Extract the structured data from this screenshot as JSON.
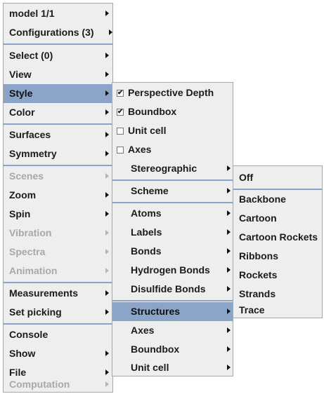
{
  "main_menu": {
    "items": [
      {
        "label": "model 1/1"
      },
      {
        "label": "Configurations (3)"
      },
      {
        "label": "Select (0)"
      },
      {
        "label": "View"
      },
      {
        "label": "Style"
      },
      {
        "label": "Color"
      },
      {
        "label": "Surfaces"
      },
      {
        "label": "Symmetry"
      },
      {
        "label": "Scenes"
      },
      {
        "label": "Zoom"
      },
      {
        "label": "Spin"
      },
      {
        "label": "Vibration"
      },
      {
        "label": "Spectra"
      },
      {
        "label": "Animation"
      },
      {
        "label": "Measurements"
      },
      {
        "label": "Set picking"
      },
      {
        "label": "Console"
      },
      {
        "label": "Show"
      },
      {
        "label": "File"
      },
      {
        "label": "Computation"
      }
    ],
    "selected": "Style"
  },
  "style_menu": {
    "items": [
      {
        "label": "Perspective Depth",
        "checked": true
      },
      {
        "label": "Boundbox",
        "checked": true
      },
      {
        "label": "Unit cell",
        "checked": false
      },
      {
        "label": "Axes",
        "checked": false
      },
      {
        "label": "Stereographic"
      },
      {
        "label": "Scheme"
      },
      {
        "label": "Atoms"
      },
      {
        "label": "Labels"
      },
      {
        "label": "Bonds"
      },
      {
        "label": "Hydrogen Bonds"
      },
      {
        "label": "Disulfide Bonds"
      },
      {
        "label": "Structures"
      },
      {
        "label": "Axes"
      },
      {
        "label": "Boundbox"
      },
      {
        "label": "Unit cell"
      }
    ],
    "selected": "Structures"
  },
  "structures_menu": {
    "items": [
      {
        "label": "Off"
      },
      {
        "label": "Backbone"
      },
      {
        "label": "Cartoon"
      },
      {
        "label": "Cartoon Rockets"
      },
      {
        "label": "Ribbons"
      },
      {
        "label": "Rockets"
      },
      {
        "label": "Strands"
      },
      {
        "label": "Trace"
      }
    ]
  },
  "icons": {
    "submenu_arrow": "submenu-arrow-icon",
    "checkbox": "checkbox-icon"
  },
  "colors": {
    "menu_bg": "#eeeeee",
    "selection_bg": "#8ba5c9",
    "separator": "#8ca4c7",
    "disabled_text": "#a8a8a8"
  }
}
